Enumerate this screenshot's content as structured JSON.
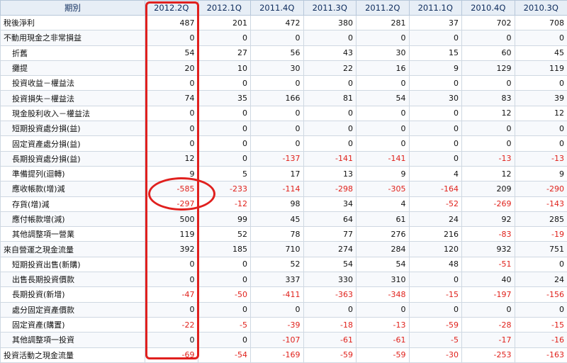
{
  "table": {
    "headers": [
      "期別",
      "2012.2Q",
      "2012.1Q",
      "2011.4Q",
      "2011.3Q",
      "2011.2Q",
      "2011.1Q",
      "2010.4Q",
      "2010.3Q"
    ],
    "rows": [
      {
        "label": "稅後淨利",
        "indent": false,
        "values": [
          "487",
          "201",
          "472",
          "380",
          "281",
          "37",
          "702",
          "708"
        ]
      },
      {
        "label": "不動用現金之非常損益",
        "indent": false,
        "values": [
          "0",
          "0",
          "0",
          "0",
          "0",
          "0",
          "0",
          "0"
        ]
      },
      {
        "label": "折舊",
        "indent": true,
        "values": [
          "54",
          "27",
          "56",
          "43",
          "30",
          "15",
          "60",
          "45"
        ]
      },
      {
        "label": "攤提",
        "indent": true,
        "values": [
          "20",
          "10",
          "30",
          "22",
          "16",
          "9",
          "129",
          "119"
        ]
      },
      {
        "label": "投資收益－權益法",
        "indent": true,
        "values": [
          "0",
          "0",
          "0",
          "0",
          "0",
          "0",
          "0",
          "0"
        ]
      },
      {
        "label": "投資損失－權益法",
        "indent": true,
        "values": [
          "74",
          "35",
          "166",
          "81",
          "54",
          "30",
          "83",
          "39"
        ]
      },
      {
        "label": "現金股利收入－權益法",
        "indent": true,
        "values": [
          "0",
          "0",
          "0",
          "0",
          "0",
          "0",
          "12",
          "12"
        ]
      },
      {
        "label": "短期投資處分損(益)",
        "indent": true,
        "values": [
          "0",
          "0",
          "0",
          "0",
          "0",
          "0",
          "0",
          "0"
        ]
      },
      {
        "label": "固定資產處分損(益)",
        "indent": true,
        "values": [
          "0",
          "0",
          "0",
          "0",
          "0",
          "0",
          "0",
          "0"
        ]
      },
      {
        "label": "長期投資處分損(益)",
        "indent": true,
        "values": [
          "12",
          "0",
          "-137",
          "-141",
          "-141",
          "0",
          "-13",
          "-13"
        ]
      },
      {
        "label": "準備提列(迴轉)",
        "indent": true,
        "values": [
          "9",
          "5",
          "17",
          "13",
          "9",
          "4",
          "12",
          "9"
        ]
      },
      {
        "label": "應收帳款(增)減",
        "indent": true,
        "values": [
          "-585",
          "-233",
          "-114",
          "-298",
          "-305",
          "-164",
          "209",
          "-290"
        ]
      },
      {
        "label": "存貨(增)減",
        "indent": true,
        "values": [
          "-297",
          "-12",
          "98",
          "34",
          "4",
          "-52",
          "-269",
          "-143"
        ]
      },
      {
        "label": "應付帳款增(減)",
        "indent": true,
        "values": [
          "500",
          "99",
          "45",
          "64",
          "61",
          "24",
          "92",
          "285"
        ]
      },
      {
        "label": "其他調整項一營業",
        "indent": true,
        "values": [
          "119",
          "52",
          "78",
          "77",
          "276",
          "216",
          "-83",
          "-19"
        ]
      },
      {
        "label": "來自營運之現金流量",
        "indent": false,
        "values": [
          "392",
          "185",
          "710",
          "274",
          "284",
          "120",
          "932",
          "751"
        ]
      },
      {
        "label": "短期投資出售(新購)",
        "indent": true,
        "values": [
          "0",
          "0",
          "52",
          "54",
          "54",
          "48",
          "-51",
          "0"
        ]
      },
      {
        "label": "出售長期投資價款",
        "indent": true,
        "values": [
          "0",
          "0",
          "337",
          "330",
          "310",
          "0",
          "40",
          "24"
        ]
      },
      {
        "label": "長期投資(新增)",
        "indent": true,
        "values": [
          "-47",
          "-50",
          "-411",
          "-363",
          "-348",
          "-15",
          "-197",
          "-156"
        ]
      },
      {
        "label": "處分固定資產價款",
        "indent": true,
        "values": [
          "0",
          "0",
          "0",
          "0",
          "0",
          "0",
          "0",
          "0"
        ]
      },
      {
        "label": "固定資產(購置)",
        "indent": true,
        "values": [
          "-22",
          "-5",
          "-39",
          "-18",
          "-13",
          "-59",
          "-28",
          "-15"
        ]
      },
      {
        "label": "其他調整項一投資",
        "indent": true,
        "values": [
          "0",
          "0",
          "-107",
          "-61",
          "-61",
          "-5",
          "-17",
          "-16"
        ]
      },
      {
        "label": "投資活動之現金流量",
        "indent": false,
        "values": [
          "-69",
          "-54",
          "-169",
          "-59",
          "-59",
          "-30",
          "-253",
          "-163"
        ]
      }
    ]
  },
  "colors": {
    "negative": "#e0211b",
    "annotation": "#e0201e",
    "header_bg": "#e7eef6"
  }
}
